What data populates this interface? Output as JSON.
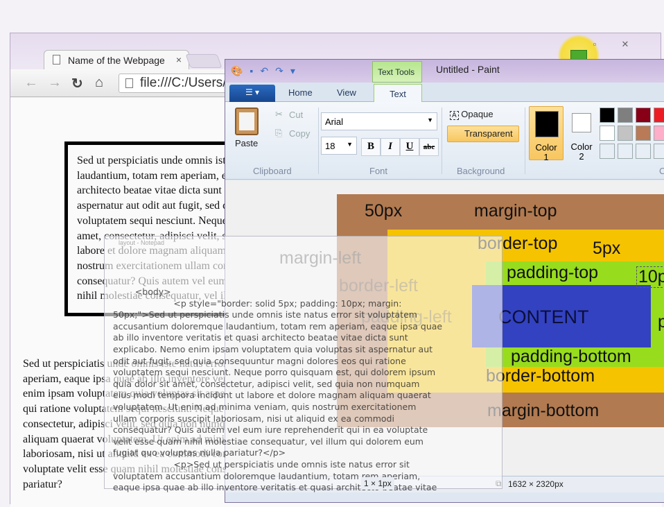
{
  "browser": {
    "tab_title": "Name of the Webpage",
    "tab_close": "×",
    "url": "file:///C:/Users/",
    "nav_icons": [
      "back-icon",
      "forward-icon",
      "reload-icon",
      "home-icon"
    ],
    "boxed_paragraph_lines": [
      "Sed ut perspiciatis unde omnis iste natus error sit voluptatem accusantium doloremque",
      "laudantium, totam rem aperiam, eaque ipsa quae ab illo inventore veritatis et quasi",
      "architecto beatae vitae dicta sunt explicabo. Nemo enim ipsam voluptatem quia voluptas sit",
      "aspernatur aut odit aut fugit, sed quia consequuntur magni dolores eos qui ratione",
      "voluptatem sequi nesciunt. Neque porro quisquam est, qui dolorem ipsum quia dolor sit",
      "amet, consectetur, adipisci velit, sed quia non numquam eius modi tempora incidunt ut",
      "labore et dolore magnam aliquam quaerat voluptatem. Ut enim ad minima veniam, quis",
      "nostrum exercitationem ullam corporis suscipit laboriosam, nisi ut aliquid ex ea commodi",
      "consequatur? Quis autem vel eum iure reprehenderit qui in ea voluptate velit esse quam",
      "nihil molestiae consequatur, vel illum qui dolorem eum fugiat quo voluptas nulla pariatur?"
    ],
    "plain_paragraph_lines": [
      "Sed ut perspiciatis unde omnis iste natus error sit voluptatem accusantium doloremque laudantium, totam rem",
      "aperiam, eaque ipsa quae ab illo inventore veritatis et quasi architecto beatae vitae dicta sunt explicabo. Nemo",
      "enim ipsam voluptatem quia voluptas sit aspernatur aut odit aut fugit, sed quia consequuntur magni dolores eos",
      "qui ratione voluptatem sequi nesciunt. Neque porro quisquam est, qui dolorem ipsum quia dolor sit amet,",
      "consectetur, adipisci velit, sed quia non numquam eius modi tempora incidunt ut labore et dolore magnam",
      "aliquam quaerat voluptatem. Ut enim ad minima veniam, quis nostrum exercitationem ullam corporis suscipit",
      "laboriosam, nisi ut aliquid ex ea commodi consequatur? Quis autem vel eum iure reprehenderit qui in ea",
      "voluptate velit esse quam nihil molestiae consequatur, vel illum qui dolorem eum fugiat quo voluptas nulla",
      "pariatur?"
    ],
    "window_controls": {
      "restore": "▫",
      "close": "✕"
    }
  },
  "paint": {
    "title": "Untitled - Paint",
    "contextual_tab": "Text Tools",
    "tabs": [
      "Home",
      "View",
      "Text"
    ],
    "clipboard": {
      "paste": "Paste",
      "cut": "Cut",
      "copy": "Copy",
      "group": "Clipboard"
    },
    "font": {
      "family": "Arial",
      "size": "18",
      "bold": "B",
      "italic": "I",
      "underline": "U",
      "strike": "abc",
      "group": "Font"
    },
    "background": {
      "opaque": "Opaque",
      "transparent": "Transparent",
      "group": "Background"
    },
    "color1": {
      "label": "Color",
      "num": "1"
    },
    "color2": {
      "label": "Color",
      "num": "2"
    },
    "colors_group": "C",
    "palette": [
      "#000000",
      "#7f7f7f",
      "#880015",
      "#ed1c24",
      "#ffffff",
      "#c3c3c3",
      "#b97a57",
      "#ffaec9"
    ],
    "status": {
      "selection": "1 × 1px",
      "canvas_size": "1632 × 2320px"
    },
    "diagram": {
      "margin_value": "50px",
      "margin_top": "margin-top",
      "margin_left": "margin-left",
      "margin_bottom": "margin-bottom",
      "border_top": "border-top",
      "border_value": "5px",
      "border_left": "border-left",
      "border_bottom": "border-bottom",
      "padding_top": "padding-top",
      "padding_value": "10p",
      "padding_left": "padding-left",
      "padding_bottom": "padding-bottom",
      "padding_right": "p",
      "content": "CONTENT",
      "colors": {
        "margin": "#b27a50",
        "border": "#f5c300",
        "padding": "#98dc1e",
        "content": "#3342c0"
      }
    }
  },
  "notepad": {
    "title": "layout - Notepad",
    "lines": [
      "        <body>",
      "                      <p style=\"border: solid 5px; padding: 10px; margin:",
      "50px;\">Sed ut perspiciatis unde omnis iste natus error sit voluptatem",
      "accusantium doloremque laudantium, totam rem aperiam, eaque ipsa quae",
      "ab illo inventore veritatis et quasi architecto beatae vitae dicta sunt",
      "explicabo. Nemo enim ipsam voluptatem quia voluptas sit aspernatur aut",
      "odit aut fugit, sed quia consequuntur magni dolores eos qui ratione",
      "voluptatem sequi nesciunt. Neque porro quisquam est, qui dolorem ipsum",
      "quia dolor sit amet, consectetur, adipisci velit, sed quia non numquam",
      "eius modi tempora incidunt ut labore et dolore magnam aliquam quaerat",
      "voluptatem. Ut enim ad minima veniam, quis nostrum exercitationem",
      "ullam corporis suscipit laboriosam, nisi ut aliquid ex ea commodi",
      "consequatur? Quis autem vel eum iure reprehenderit qui in ea voluptate",
      "velit esse quam nihil molestiae consequatur, vel illum qui dolorem eum",
      "fugiat quo voluptas nulla pariatur?</p>",
      "                      <p>Sed ut perspiciatis unde omnis iste natus error sit",
      "voluptatem accusantium doloremque laudantium, totam rem aperiam,",
      "eaque ipsa quae ab illo inventore veritatis et quasi architecto beatae vitae"
    ]
  }
}
